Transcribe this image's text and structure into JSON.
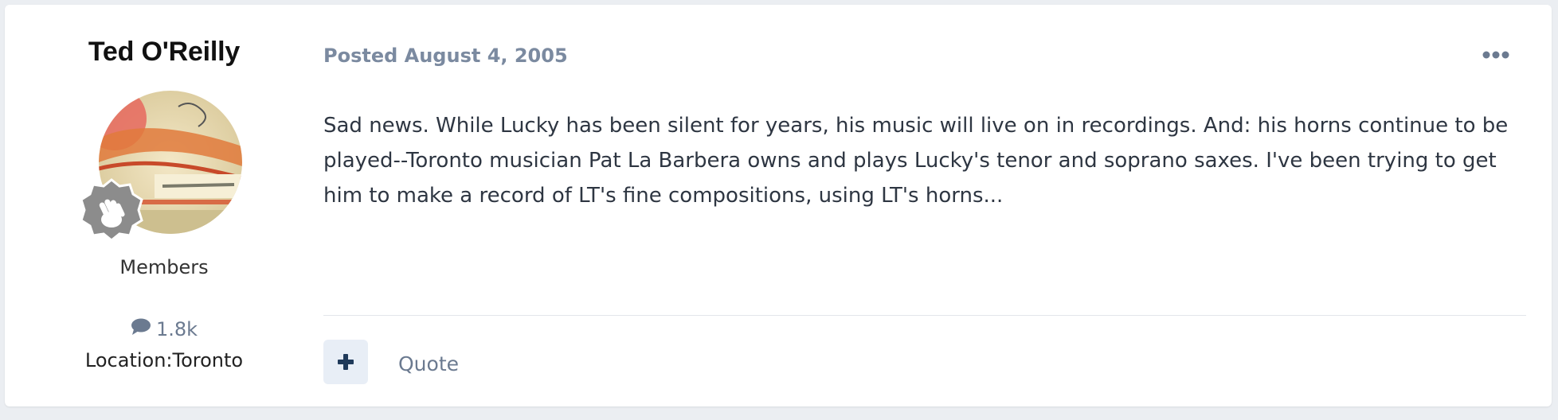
{
  "author": {
    "name": "Ted O'Reilly",
    "group": "Members",
    "post_count": "1.8k",
    "location": "Location:Toronto",
    "avatar_icon": "avatar-image",
    "badge_icon": "waving-hand-icon"
  },
  "post": {
    "posted": "Posted August 4, 2005",
    "body": "Sad news. While Lucky has been silent for years, his music will live on in recordings. And: his horns continue to be played--Toronto musician Pat La Barbera owns and plays Lucky's tenor and soprano saxes. I've been trying to get him to make a record of LT's fine compositions, using LT's horns...",
    "more_icon": "ellipsis-icon"
  },
  "actions": {
    "reaction_icon": "plus-icon",
    "quote_label": "Quote"
  },
  "colors": {
    "accent": "#1f3a5a",
    "muted": "#6b7a90",
    "reaction_bg": "#e8eef6"
  }
}
